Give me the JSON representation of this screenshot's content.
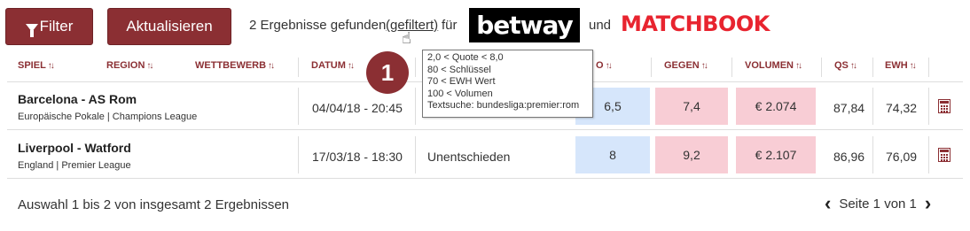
{
  "toolbar": {
    "filter_label": "Filter",
    "update_label": "Aktualisieren",
    "results_text": "2 Ergebnisse gefunden",
    "filtered_link": "(gefiltert)",
    "for_text": "für",
    "and_text": "und",
    "bookmaker_1": "betway",
    "bookmaker_2": "MATCHBOOK"
  },
  "table": {
    "columns": [
      {
        "label": "SPIEL",
        "sort_icon": "sort-arrows-icon"
      },
      {
        "label": "REGION",
        "sort_icon": "sort-arrows-icon"
      },
      {
        "label": "WETTBEWERB",
        "sort_icon": "sort-arrows-icon"
      },
      {
        "label": "DATUM",
        "sort_icon": "sort-arrows-icon"
      },
      {
        "label": "O",
        "sort_icon": "sort-arrows-icon"
      },
      {
        "label": "GEGEN",
        "sort_icon": "sort-arrows-icon"
      },
      {
        "label": "VOLUMEN",
        "sort_icon": "sort-arrows-icon"
      },
      {
        "label": "QS",
        "sort_icon": "sort-arrows-icon"
      },
      {
        "label": "EWH",
        "sort_icon": "sort-arrows-icon"
      }
    ],
    "rows": [
      {
        "match": "Barcelona - AS Rom",
        "competition": "Europäische Pokale | Champions League",
        "date": "04/04/18 - 20:45",
        "bet": "",
        "odds": "6,5",
        "lay": "7,4",
        "volume": "€ 2.074",
        "qs": "87,84",
        "ewh": "74,32"
      },
      {
        "match": "Liverpool - Watford",
        "competition": "England | Premier League",
        "date": "17/03/18 - 18:30",
        "bet": "Unentschieden",
        "odds": "8",
        "lay": "9,2",
        "volume": "€ 2.107",
        "qs": "86,96",
        "ewh": "76,09"
      }
    ]
  },
  "tooltip": {
    "lines": [
      "2,0 < Quote < 8,0",
      "80 < Schlüssel",
      "70 < EWH Wert",
      "100 < Volumen",
      "Textsuche: bundesliga:premier:rom"
    ]
  },
  "badge": {
    "number": "1"
  },
  "footer": {
    "summary": "Auswahl 1 bis 2 von insgesamt 2 Ergebnissen",
    "page_text": "Seite 1 von 1"
  },
  "colors": {
    "brand": "#8b2f33",
    "back_cell": "#d6e6fb",
    "lay_cell": "#f8cdd5",
    "matchbook": "#e8242f"
  }
}
